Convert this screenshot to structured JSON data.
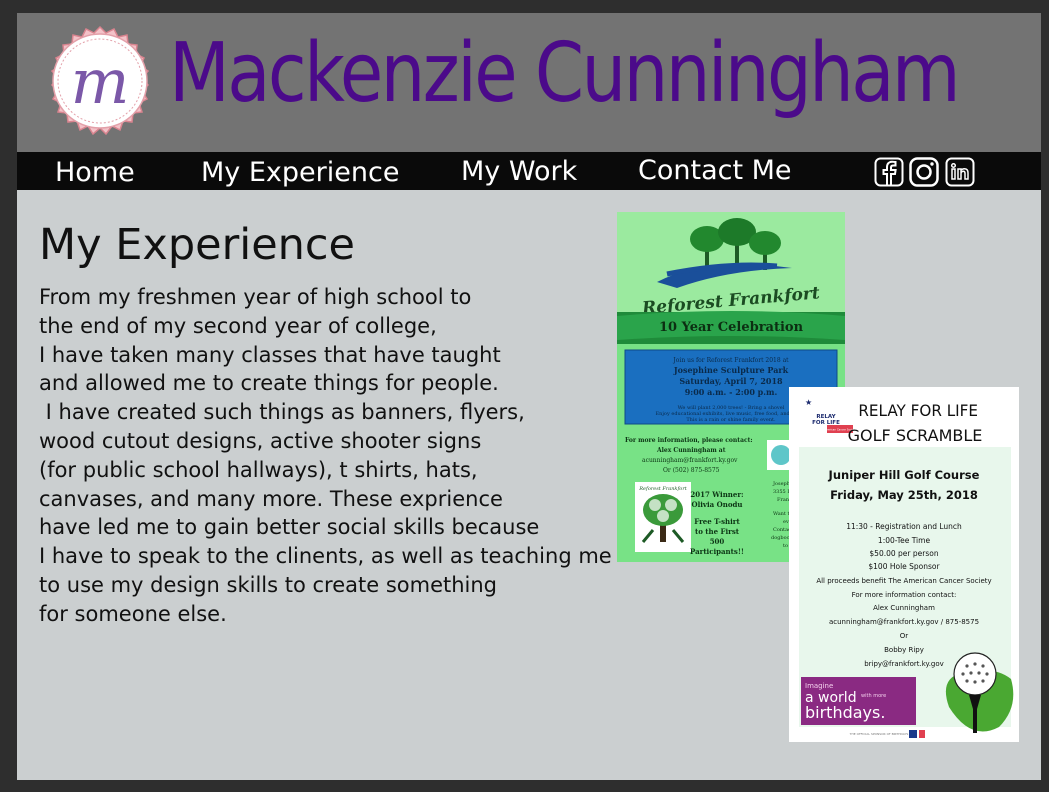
{
  "header": {
    "logo_letter": "m",
    "site_title": "Mackenzie Cunningham"
  },
  "nav": {
    "items": [
      {
        "label": "Home"
      },
      {
        "label": "My Experience"
      },
      {
        "label": "My Work"
      },
      {
        "label": "Contact Me"
      }
    ],
    "social": [
      {
        "icon": "facebook-icon"
      },
      {
        "icon": "instagram-icon"
      },
      {
        "icon": "linkedin-icon"
      }
    ]
  },
  "main": {
    "heading": "My Experience",
    "paragraph": [
      "From my freshmen year of high school to",
      "the end of my second year of college,",
      "I have taken many classes that have taught",
      "and allowed me to create things for people.",
      " I have created such things as banners, flyers,",
      "wood cutout designs, active shooter signs",
      "(for public school hallways), t shirts, hats,",
      "canvases, and many more. These exprience",
      "have led me to gain better social skills because",
      "I have to speak to the clinents, as well as teaching me",
      "to use my design skills to create something",
      "for someone else."
    ]
  },
  "flyer_reforest": {
    "title": "Reforest Frankfort",
    "banner": "10 Year Celebration",
    "join_line1": "Join us for Reforest Frankfort 2018 at",
    "location": "Josephine Sculpture Park",
    "date": "Saturday, April 7, 2018",
    "time": "9:00 a.m. - 2:00 p.m.",
    "plant_line": "We will plant 2,000 trees! - Bring a shovel",
    "enjoy_line": "Enjoy educational exhibits, live music, free food, and more!",
    "rain_line": "This is a rain or shine family event.",
    "contact_heading": "For more information, please contact:",
    "contact_name": "Alex Cunningham at",
    "contact_email": "acunningham@frankfort.ky.gov",
    "contact_phone": "Or (502) 875-8575",
    "winner_label": "2017 Winner:",
    "winner_name": "Olivia Onodu",
    "tshirt_line1": "Free T-shirt",
    "tshirt_line2": "to the First",
    "tshirt_line3": "500",
    "tshirt_line4": "Participants!!",
    "side_text1": "Josephine",
    "side_text2": "3355 La",
    "side_text3": "Frankf",
    "side_text4": "Want to",
    "side_text5": "ev",
    "side_text6": "Contact",
    "side_text7": "dogbocky",
    "side_text8": "to",
    "logo_caption": "Reforest Frankfort"
  },
  "flyer_relay": {
    "logo_line1": "RELAY",
    "logo_line2": "FOR LIFE",
    "logo_sub": "American Cancer Society",
    "title_line1": "RELAY FOR LIFE",
    "title_line2": "GOLF SCRAMBLE",
    "course": "Juniper Hill Golf Course",
    "date": "Friday, May 25th, 2018",
    "schedule": [
      "11:30 - Registration and Lunch",
      "1:00-Tee Time",
      "$50.00 per person",
      "$100 Hole Sponsor",
      "All proceeds benefit The American Cancer Society",
      "For more information contact:",
      "Alex Cunningham",
      "acunningham@frankfort.ky.gov / 875-8575",
      "Or",
      "Bobby Ripy",
      "bripy@frankfort.ky.gov"
    ],
    "ad_imagine": "Imagine",
    "ad_world": "a world",
    "ad_with_more": "with more",
    "ad_birthdays": "birthdays.",
    "footer": "THE OFFICIAL SPONSOR OF BIRTHDAYS"
  },
  "colors": {
    "page_bg": "#2e2e2e",
    "content_bg": "#cbcfd0",
    "header_bg": "#737373",
    "title_purple": "#4b0a8a",
    "nav_bg": "#0a0a0a",
    "flyer_green": "#6fdf7c",
    "flyer_blue": "#1a6fc0",
    "relay_purple": "#8a2a82"
  }
}
